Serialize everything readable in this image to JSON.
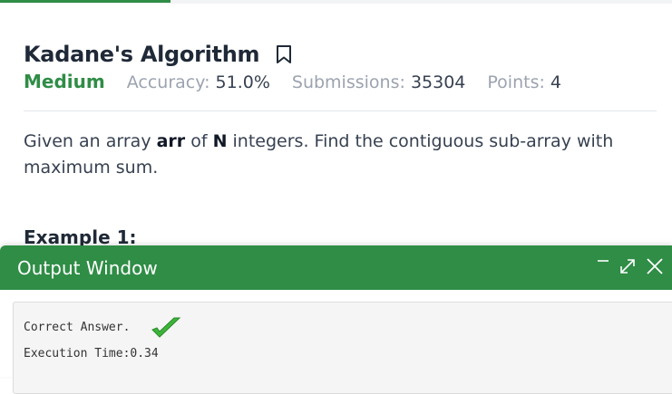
{
  "problem": {
    "title": "Kadane's Algorithm",
    "difficulty": "Medium",
    "accuracy_label": "Accuracy:",
    "accuracy_value": "51.0%",
    "submissions_label": "Submissions:",
    "submissions_value": "35304",
    "points_label": "Points:",
    "points_value": "4"
  },
  "statement": {
    "part1": "Given an array ",
    "arr": "arr",
    "part2": " of ",
    "n": "N",
    "part3": " integers. Find the contiguous sub-array with maximum sum."
  },
  "example_heading": "Example 1:",
  "output_window": {
    "title": "Output Window",
    "minimize_symbol": "—",
    "expand_symbol": "↗",
    "close_symbol": "✕",
    "result_text": "Correct Answer.",
    "execution_time": "Execution Time:0.34"
  },
  "colors": {
    "accent_green": "#2f8d46",
    "check_green": "#3cb53a"
  },
  "icons": {
    "bookmark": "bookmark-icon",
    "checkmark": "checkmark-icon",
    "minimize": "minimize-icon",
    "expand": "expand-icon",
    "close": "close-icon"
  }
}
